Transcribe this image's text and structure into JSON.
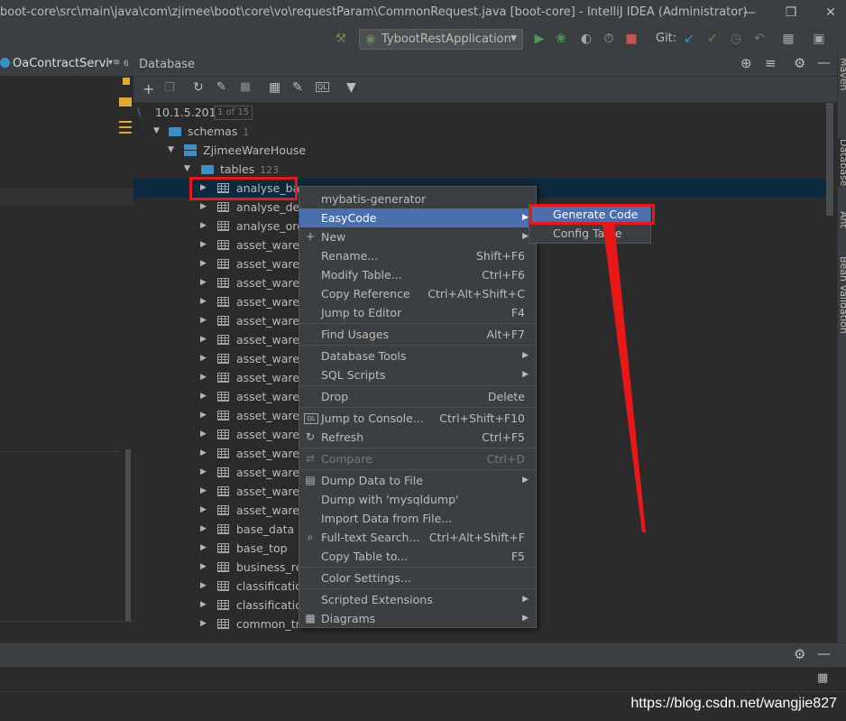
{
  "window": {
    "title": "boot-core\\src\\main\\java\\com\\zjimee\\boot\\core\\vo\\requestParam\\CommonRequest.java [boot-core] - IntelliJ IDEA (Administrator)"
  },
  "toolbar": {
    "run_config": "TybootRestApplication",
    "git_label": "Git:"
  },
  "left_panel": {
    "tab_title": "OaContractServi",
    "tab_badge": "6"
  },
  "db_panel": {
    "title": "Database"
  },
  "tree": {
    "host": {
      "label": "10.1.5.201",
      "badge": "1 of 15"
    },
    "schemas": {
      "label": "schemas",
      "count": "1"
    },
    "db": {
      "label": "ZjimeeWareHouse"
    },
    "tables": {
      "label": "tables",
      "count": "123"
    },
    "rows": [
      "analyse_ba",
      "analyse_det",
      "analyse_ord",
      "asset_wareh",
      "asset_wareh",
      "asset_wareh",
      "asset_wareh",
      "asset_wareh",
      "asset_wareh",
      "asset_wareh",
      "asset_wareh",
      "asset_wareh",
      "asset_wareh",
      "asset_wareh",
      "asset_wareh",
      "asset_wareh",
      "asset_wareh",
      "asset_wareh",
      "base_data",
      "base_top",
      "business_re",
      "classificatio",
      "classificatio",
      "common_tre"
    ]
  },
  "context_menu": {
    "items": [
      {
        "label": "mybatis-generator",
        "shortcut": ""
      },
      {
        "label": "EasyCode",
        "shortcut": ""
      },
      {
        "label": "New",
        "shortcut": ""
      },
      {
        "label": "Rename...",
        "shortcut": "Shift+F6"
      },
      {
        "label": "Modify Table...",
        "shortcut": "Ctrl+F6"
      },
      {
        "label": "Copy Reference",
        "shortcut": "Ctrl+Alt+Shift+C"
      },
      {
        "label": "Jump to Editor",
        "shortcut": "F4"
      },
      {
        "label": "Find Usages",
        "shortcut": "Alt+F7"
      },
      {
        "label": "Database Tools",
        "shortcut": ""
      },
      {
        "label": "SQL Scripts",
        "shortcut": ""
      },
      {
        "label": "Drop",
        "shortcut": "Delete"
      },
      {
        "label": "Jump to Console...",
        "shortcut": "Ctrl+Shift+F10"
      },
      {
        "label": "Refresh",
        "shortcut": "Ctrl+F5"
      },
      {
        "label": "Compare",
        "shortcut": "Ctrl+D"
      },
      {
        "label": "Dump Data to File",
        "shortcut": ""
      },
      {
        "label": "Dump with 'mysqldump'",
        "shortcut": ""
      },
      {
        "label": "Import Data from File...",
        "shortcut": ""
      },
      {
        "label": "Full-text Search...",
        "shortcut": "Ctrl+Alt+Shift+F"
      },
      {
        "label": "Copy Table to...",
        "shortcut": "F5"
      },
      {
        "label": "Color Settings...",
        "shortcut": ""
      },
      {
        "label": "Scripted Extensions",
        "shortcut": ""
      },
      {
        "label": "Diagrams",
        "shortcut": ""
      }
    ]
  },
  "submenu": {
    "items": [
      {
        "label": "Generate Code"
      },
      {
        "label": "Config Table"
      }
    ]
  },
  "right_strip": {
    "tabs": [
      "Maven",
      "Database",
      "Ant",
      "Bean Validation"
    ]
  },
  "watermark": "https://blog.csdn.net/wangjie827",
  "colors": {
    "background": "#2b2b2b",
    "panel": "#3c3f41",
    "selection": "#4b6eaf",
    "annotation": "#e81818"
  }
}
